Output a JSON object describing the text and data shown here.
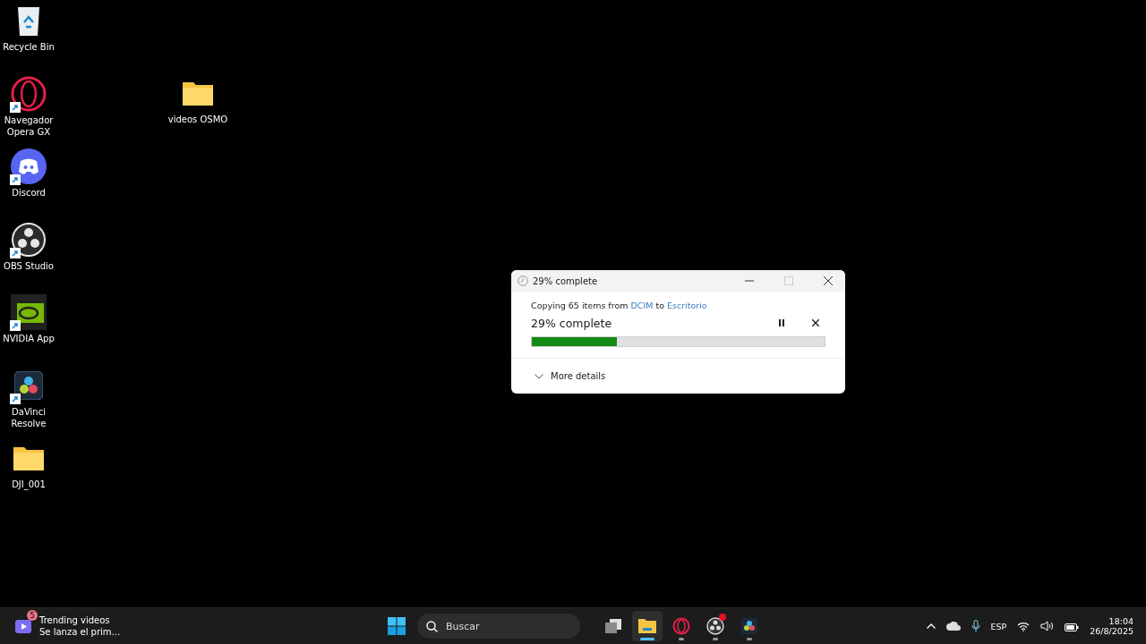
{
  "desktop_icons": [
    {
      "label": "Recycle Bin",
      "kind": "recycle",
      "shortcut": false
    },
    {
      "label": "Navegador Opera GX",
      "kind": "opera",
      "shortcut": true
    },
    {
      "label": "Discord",
      "kind": "discord",
      "shortcut": true
    },
    {
      "label": "OBS Studio",
      "kind": "obs",
      "shortcut": true
    },
    {
      "label": "NVIDIA App",
      "kind": "nvidia",
      "shortcut": true
    },
    {
      "label": "DaVinci Resolve",
      "kind": "davinci",
      "shortcut": true
    },
    {
      "label": "DJI_001",
      "kind": "folder",
      "shortcut": false
    }
  ],
  "folder": {
    "label": "videos OSMO"
  },
  "dialog": {
    "title": "29% complete",
    "copy_text": "Copying 65 items from",
    "source": "DCIM",
    "joiner": "to",
    "destination": "Escritorio",
    "heading": "29% complete",
    "level": 0.29,
    "details": "More details"
  },
  "taskbar": {
    "widget": {
      "badge": "5",
      "title": "Trending videos",
      "subtitle": "Se lanza el prim..."
    },
    "search": {
      "placeholder": "Buscar"
    },
    "apps": [
      {
        "kind": "taskview",
        "selected": false,
        "running": false,
        "alert": false
      },
      {
        "kind": "explorer",
        "selected": true,
        "running": true,
        "alert": false
      },
      {
        "kind": "opera",
        "selected": false,
        "running": true,
        "alert": false
      },
      {
        "kind": "obs",
        "selected": false,
        "running": true,
        "alert": true
      },
      {
        "kind": "davinci",
        "selected": false,
        "running": true,
        "alert": false
      }
    ],
    "language": "ESP",
    "time": "18:04",
    "date": "26/8/2025"
  }
}
